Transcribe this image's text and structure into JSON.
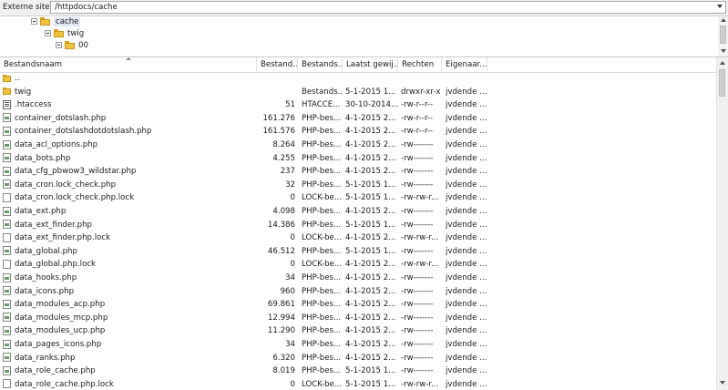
{
  "site_bar": {
    "label": "Externe site:",
    "path": "/httpdocs/cache"
  },
  "tree": [
    {
      "label": "cache",
      "selected": true
    },
    {
      "label": "twig",
      "selected": false
    },
    {
      "label": "00",
      "selected": false
    }
  ],
  "columns": [
    "Bestandsnaam",
    "Bestand...",
    "Bestands...",
    "Laatst gewij...",
    "Rechten",
    "Eigenaar..."
  ],
  "files": [
    {
      "name": "..",
      "size": "",
      "type": "",
      "date": "",
      "perm": "",
      "owner": "",
      "icon": "folder"
    },
    {
      "name": "twig",
      "size": "",
      "type": "Bestands...",
      "date": "5-1-2015 1...",
      "perm": "drwxr-xr-x",
      "owner": "jvdende ...",
      "icon": "folder"
    },
    {
      "name": ".htaccess",
      "size": "51",
      "type": "HTACCE...",
      "date": "30-10-2014...",
      "perm": "-rw-r--r--",
      "owner": "jvdende ...",
      "icon": "htaccess"
    },
    {
      "name": "container_dotslash.php",
      "size": "161.276",
      "type": "PHP-bes...",
      "date": "4-1-2015 2...",
      "perm": "-rw-r--r--",
      "owner": "jvdende ...",
      "icon": "php"
    },
    {
      "name": "container_dotslashdotdotslash.php",
      "size": "161.576",
      "type": "PHP-bes...",
      "date": "4-1-2015 2...",
      "perm": "-rw-r--r--",
      "owner": "jvdende ...",
      "icon": "php"
    },
    {
      "name": "data_acl_options.php",
      "size": "8.264",
      "type": "PHP-bes...",
      "date": "4-1-2015 2...",
      "perm": "-rw-------",
      "owner": "jvdende ...",
      "icon": "php"
    },
    {
      "name": "data_bots.php",
      "size": "4.255",
      "type": "PHP-bes...",
      "date": "4-1-2015 2...",
      "perm": "-rw-------",
      "owner": "jvdende ...",
      "icon": "php"
    },
    {
      "name": "data_cfg_pbwow3_wildstar.php",
      "size": "237",
      "type": "PHP-bes...",
      "date": "4-1-2015 2...",
      "perm": "-rw-------",
      "owner": "jvdende ...",
      "icon": "php"
    },
    {
      "name": "data_cron.lock_check.php",
      "size": "32",
      "type": "PHP-bes...",
      "date": "5-1-2015 1...",
      "perm": "-rw-------",
      "owner": "jvdende ...",
      "icon": "php"
    },
    {
      "name": "data_cron.lock_check.php.lock",
      "size": "0",
      "type": "LOCK-be...",
      "date": "5-1-2015 1...",
      "perm": "-rw-rw-r...",
      "owner": "jvdende ...",
      "icon": "file"
    },
    {
      "name": "data_ext.php",
      "size": "4.098",
      "type": "PHP-bes...",
      "date": "4-1-2015 2...",
      "perm": "-rw-------",
      "owner": "jvdende ...",
      "icon": "php"
    },
    {
      "name": "data_ext_finder.php",
      "size": "14.386",
      "type": "PHP-bes...",
      "date": "5-1-2015 1...",
      "perm": "-rw-------",
      "owner": "jvdende ...",
      "icon": "php"
    },
    {
      "name": "data_ext_finder.php.lock",
      "size": "0",
      "type": "LOCK-be...",
      "date": "4-1-2015 2...",
      "perm": "-rw-rw-r...",
      "owner": "jvdende ...",
      "icon": "file"
    },
    {
      "name": "data_global.php",
      "size": "46.512",
      "type": "PHP-bes...",
      "date": "5-1-2015 1...",
      "perm": "-rw-------",
      "owner": "jvdende ...",
      "icon": "php"
    },
    {
      "name": "data_global.php.lock",
      "size": "0",
      "type": "LOCK-be...",
      "date": "4-1-2015 2...",
      "perm": "-rw-rw-r...",
      "owner": "jvdende ...",
      "icon": "file"
    },
    {
      "name": "data_hooks.php",
      "size": "34",
      "type": "PHP-bes...",
      "date": "4-1-2015 2...",
      "perm": "-rw-------",
      "owner": "jvdende ...",
      "icon": "php"
    },
    {
      "name": "data_icons.php",
      "size": "960",
      "type": "PHP-bes...",
      "date": "4-1-2015 2...",
      "perm": "-rw-------",
      "owner": "jvdende ...",
      "icon": "php"
    },
    {
      "name": "data_modules_acp.php",
      "size": "69.861",
      "type": "PHP-bes...",
      "date": "4-1-2015 2...",
      "perm": "-rw-------",
      "owner": "jvdende ...",
      "icon": "php"
    },
    {
      "name": "data_modules_mcp.php",
      "size": "12.994",
      "type": "PHP-bes...",
      "date": "4-1-2015 2...",
      "perm": "-rw-------",
      "owner": "jvdende ...",
      "icon": "php"
    },
    {
      "name": "data_modules_ucp.php",
      "size": "11.290",
      "type": "PHP-bes...",
      "date": "4-1-2015 2...",
      "perm": "-rw-------",
      "owner": "jvdende ...",
      "icon": "php"
    },
    {
      "name": "data_pages_icons.php",
      "size": "34",
      "type": "PHP-bes...",
      "date": "4-1-2015 2...",
      "perm": "-rw-------",
      "owner": "jvdende ...",
      "icon": "php"
    },
    {
      "name": "data_ranks.php",
      "size": "6.320",
      "type": "PHP-bes...",
      "date": "4-1-2015 2...",
      "perm": "-rw-------",
      "owner": "jvdende ...",
      "icon": "php"
    },
    {
      "name": "data_role_cache.php",
      "size": "8.019",
      "type": "PHP-bes...",
      "date": "5-1-2015 1...",
      "perm": "-rw-------",
      "owner": "jvdende ...",
      "icon": "php"
    },
    {
      "name": "data_role_cache.php.lock",
      "size": "0",
      "type": "LOCK-be...",
      "date": "5-1-2015 1...",
      "perm": "-rw-rw-r...",
      "owner": "jvdende ...",
      "icon": "file"
    }
  ]
}
